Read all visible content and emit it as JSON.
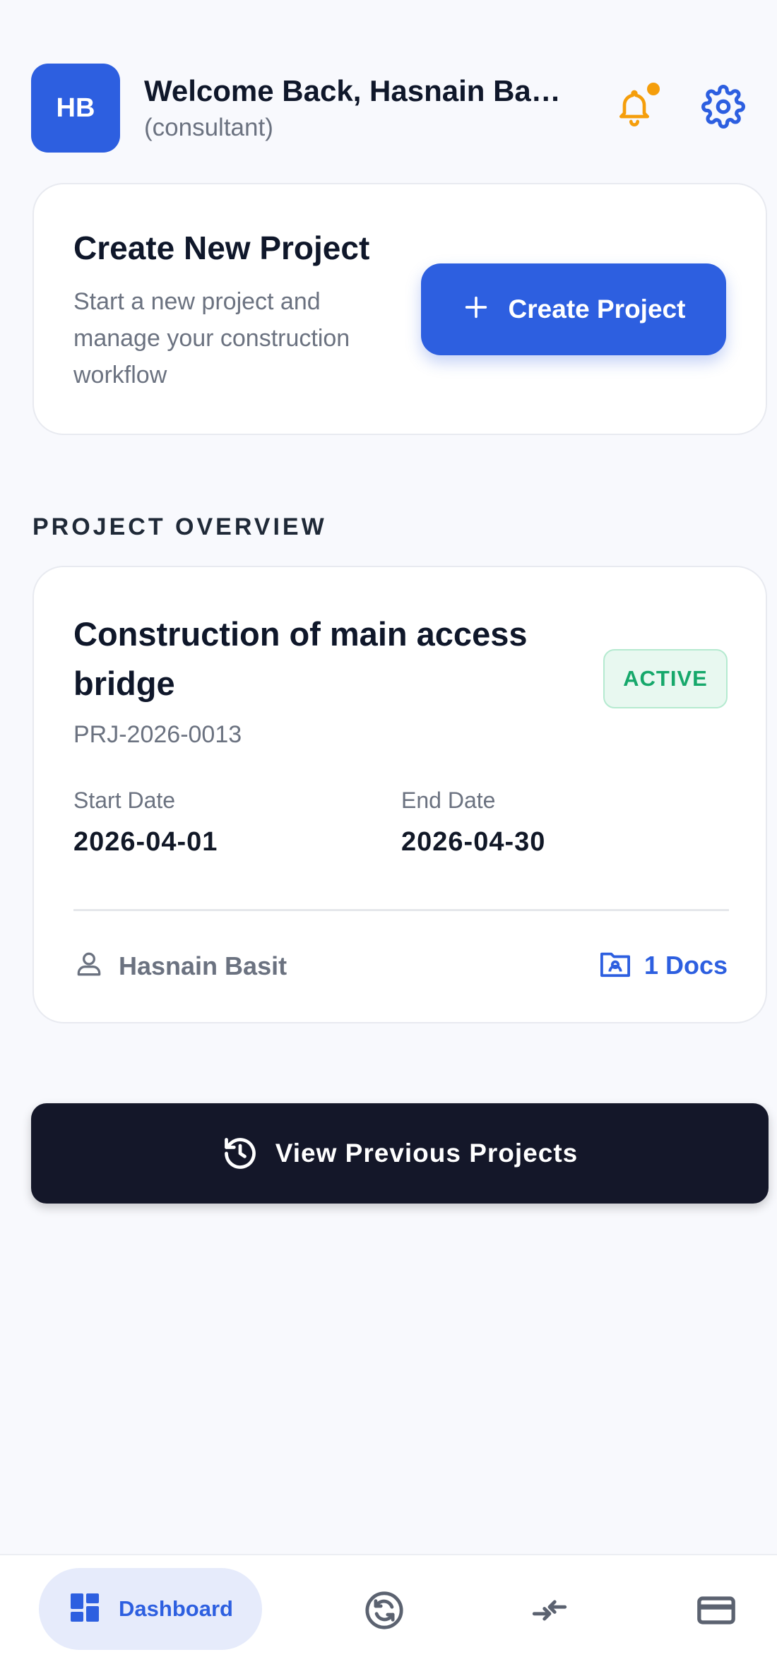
{
  "header": {
    "avatar_initials": "HB",
    "welcome": "Welcome Back, Hasnain Basit",
    "role": "(consultant)",
    "notification_icon": "bell-icon",
    "settings_icon": "gear-icon"
  },
  "create_card": {
    "title": "Create New Project",
    "description": "Start a new project and manage your construction workflow",
    "button_icon": "plus-icon",
    "button_label": "Create Project"
  },
  "overview": {
    "section_title": "PROJECT OVERVIEW",
    "project": {
      "name": "Construction of main access bridge",
      "status": "ACTIVE",
      "id": "PRJ-2026-0013",
      "start_label": "Start Date",
      "start_date": "2026-04-01",
      "end_label": "End Date",
      "end_date": "2026-04-30",
      "owner": "Hasnain Basit",
      "docs": "1 Docs"
    }
  },
  "previous_button": {
    "icon": "history-icon",
    "label": "View Previous Projects"
  },
  "bottom_nav": {
    "items": [
      {
        "label": "Dashboard",
        "icon": "dashboard-icon",
        "active": true
      },
      {
        "label": "",
        "icon": "sync-icon"
      },
      {
        "label": "",
        "icon": "compare-arrows-icon"
      },
      {
        "label": "",
        "icon": "credit-card-icon"
      }
    ]
  },
  "colors": {
    "primary": "#2d5fe0",
    "dark_button": "#141729",
    "active_green": "#16a86b",
    "notification_dot": "#f59e0b",
    "background": "#f8f9fd"
  }
}
